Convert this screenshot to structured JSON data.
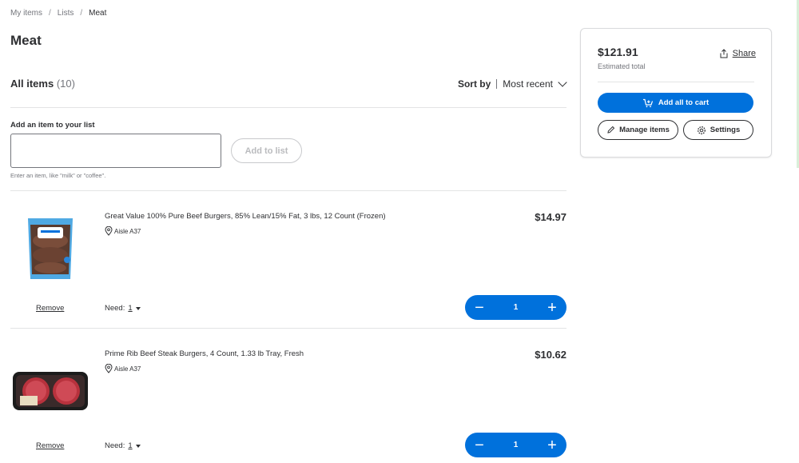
{
  "breadcrumb": {
    "items": [
      "My items",
      "Lists"
    ],
    "current": "Meat"
  },
  "page": {
    "title": "Meat"
  },
  "list": {
    "all_items_label": "All items",
    "count": "(10)",
    "sort_label": "Sort by",
    "sort_value": "Most recent"
  },
  "add_item": {
    "label": "Add an item to your list",
    "placeholder": "",
    "value": "",
    "button": "Add to list",
    "hint": "Enter an item, like \"milk\" or \"coffee\"."
  },
  "items": [
    {
      "name": "Great Value 100% Pure Beef Burgers, 85% Lean/15% Fat, 3 lbs, 12 Count (Frozen)",
      "aisle": "Aisle A37",
      "price": "$14.97",
      "remove": "Remove",
      "need_label": "Need:",
      "need_value": "1",
      "qty": "1",
      "thumb_icon": "frozen-burger-bag-icon"
    },
    {
      "name": "Prime Rib Beef Steak Burgers, 4 Count, 1.33 lb Tray, Fresh",
      "aisle": "Aisle A37",
      "price": "$10.62",
      "remove": "Remove",
      "need_label": "Need:",
      "need_value": "1",
      "qty": "1",
      "thumb_icon": "burger-tray-icon"
    }
  ],
  "summary": {
    "total": "$121.91",
    "total_label": "Estimated total",
    "share": "Share",
    "add_all": "Add all to cart",
    "manage": "Manage items",
    "settings": "Settings"
  },
  "colors": {
    "primary": "#0071dc",
    "text": "#2e2f32",
    "muted": "#74767c"
  }
}
